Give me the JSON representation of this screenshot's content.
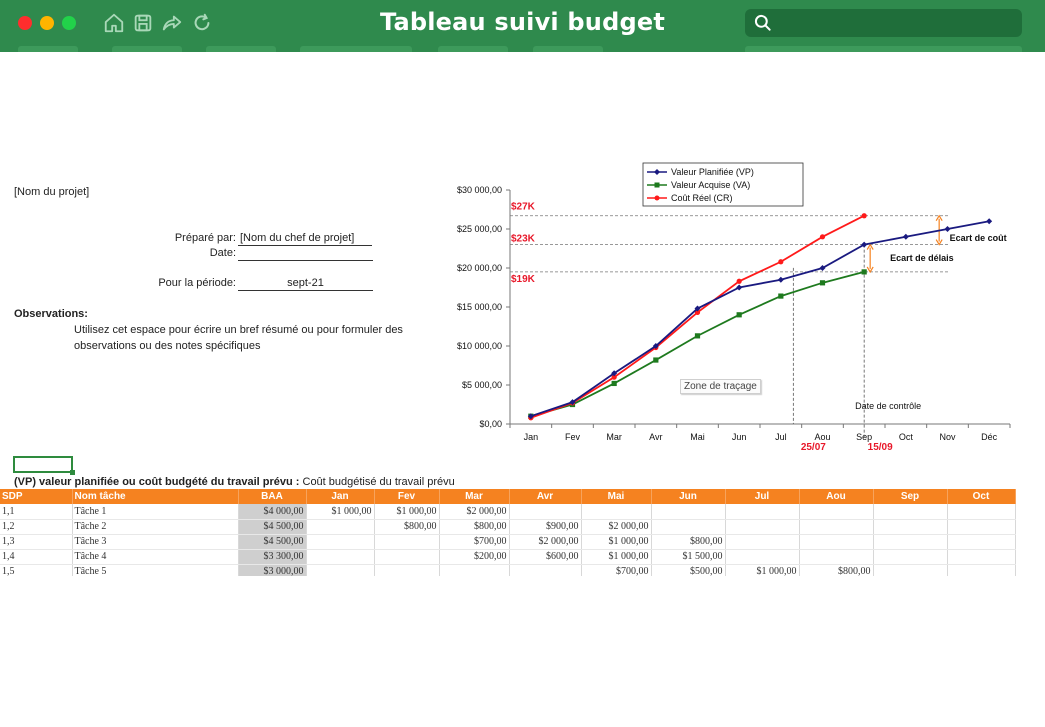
{
  "window": {
    "title": "Tableau suivi budget",
    "search_placeholder": "",
    "accent": "#2f8a4d"
  },
  "form": {
    "project_name": "[Nom du projet]",
    "prepared_by_label": "Préparé par:",
    "prepared_by_value": "[Nom du chef de projet]",
    "date_label": "Date:",
    "date_value": "",
    "period_label": "Pour la période:",
    "period_value": "sept-21",
    "observations_label": "Observations:",
    "observations_text": "Utilisez cet espace pour écrire un bref résumé ou pour formuler des observations ou des notes spécifiques"
  },
  "chart_data": {
    "type": "line",
    "categories": [
      "Jan",
      "Fev",
      "Mar",
      "Avr",
      "Mai",
      "Jun",
      "Jul",
      "Aou",
      "Sep",
      "Oct",
      "Nov",
      "Déc"
    ],
    "ylim": [
      0,
      30000
    ],
    "y_ticks": [
      "$0,00",
      "$5 000,00",
      "$10 000,00",
      "$15 000,00",
      "$20 000,00",
      "$25 000,00",
      "$30 000,00"
    ],
    "legend_position": "top",
    "series": [
      {
        "name": "Valeur Planifiée (VP)",
        "color": "#1a1a80",
        "marker": "diamond",
        "values": [
          1000,
          2800,
          6500,
          10000,
          14800,
          17500,
          18500,
          20000,
          23000,
          24000,
          25000,
          26000
        ]
      },
      {
        "name": "Valeur Acquise (VA)",
        "color": "#1e7a1e",
        "marker": "square",
        "values": [
          1000,
          2500,
          5200,
          8200,
          11300,
          14000,
          16400,
          18100,
          19500
        ]
      },
      {
        "name": "Coût Réel (CR)",
        "color": "#ff1a1a",
        "marker": "circle",
        "values": [
          800,
          2700,
          6000,
          9800,
          14300,
          18300,
          20800,
          24000,
          26700
        ]
      }
    ],
    "annotations": {
      "cost_27k": "$27K",
      "cost_23k": "$23K",
      "cost_19k": "$19K",
      "date_2507": "25/07",
      "date_1509": "15/09",
      "cost_variance": "Ecart de coût",
      "schedule_variance": "Ecart de délais",
      "control_date": "Date de contrôle"
    },
    "plot_area_label": "Zone de traçage"
  },
  "table": {
    "title_bold": "(VP) valeur planifiée ou coût budgété du travail prévu :",
    "title_rest": " Coût budgétisé du travail prévu",
    "headers": [
      "SDP",
      "Nom tâche",
      "BAA",
      "Jan",
      "Fev",
      "Mar",
      "Avr",
      "Mai",
      "Jun",
      "Jul",
      "Aou",
      "Sep",
      "Oct"
    ],
    "rows": [
      [
        "1,1",
        "Tâche 1",
        "$4 000,00",
        "$1 000,00",
        "$1 000,00",
        "$2 000,00",
        "",
        "",
        "",
        "",
        "",
        "",
        ""
      ],
      [
        "1,2",
        "Tâche 2",
        "$4 500,00",
        "",
        "$800,00",
        "$800,00",
        "$900,00",
        "$2 000,00",
        "",
        "",
        "",
        "",
        ""
      ],
      [
        "1,3",
        "Tâche 3",
        "$4 500,00",
        "",
        "",
        "$700,00",
        "$2 000,00",
        "$1 000,00",
        "$800,00",
        "",
        "",
        "",
        ""
      ],
      [
        "1,4",
        "Tâche 4",
        "$3 300,00",
        "",
        "",
        "$200,00",
        "$600,00",
        "$1 000,00",
        "$1 500,00",
        "",
        "",
        "",
        ""
      ],
      [
        "1,5",
        "Tâche 5",
        "$3 000,00",
        "",
        "",
        "",
        "",
        "$700,00",
        "$500,00",
        "$1 000,00",
        "$800,00",
        "",
        ""
      ]
    ]
  }
}
